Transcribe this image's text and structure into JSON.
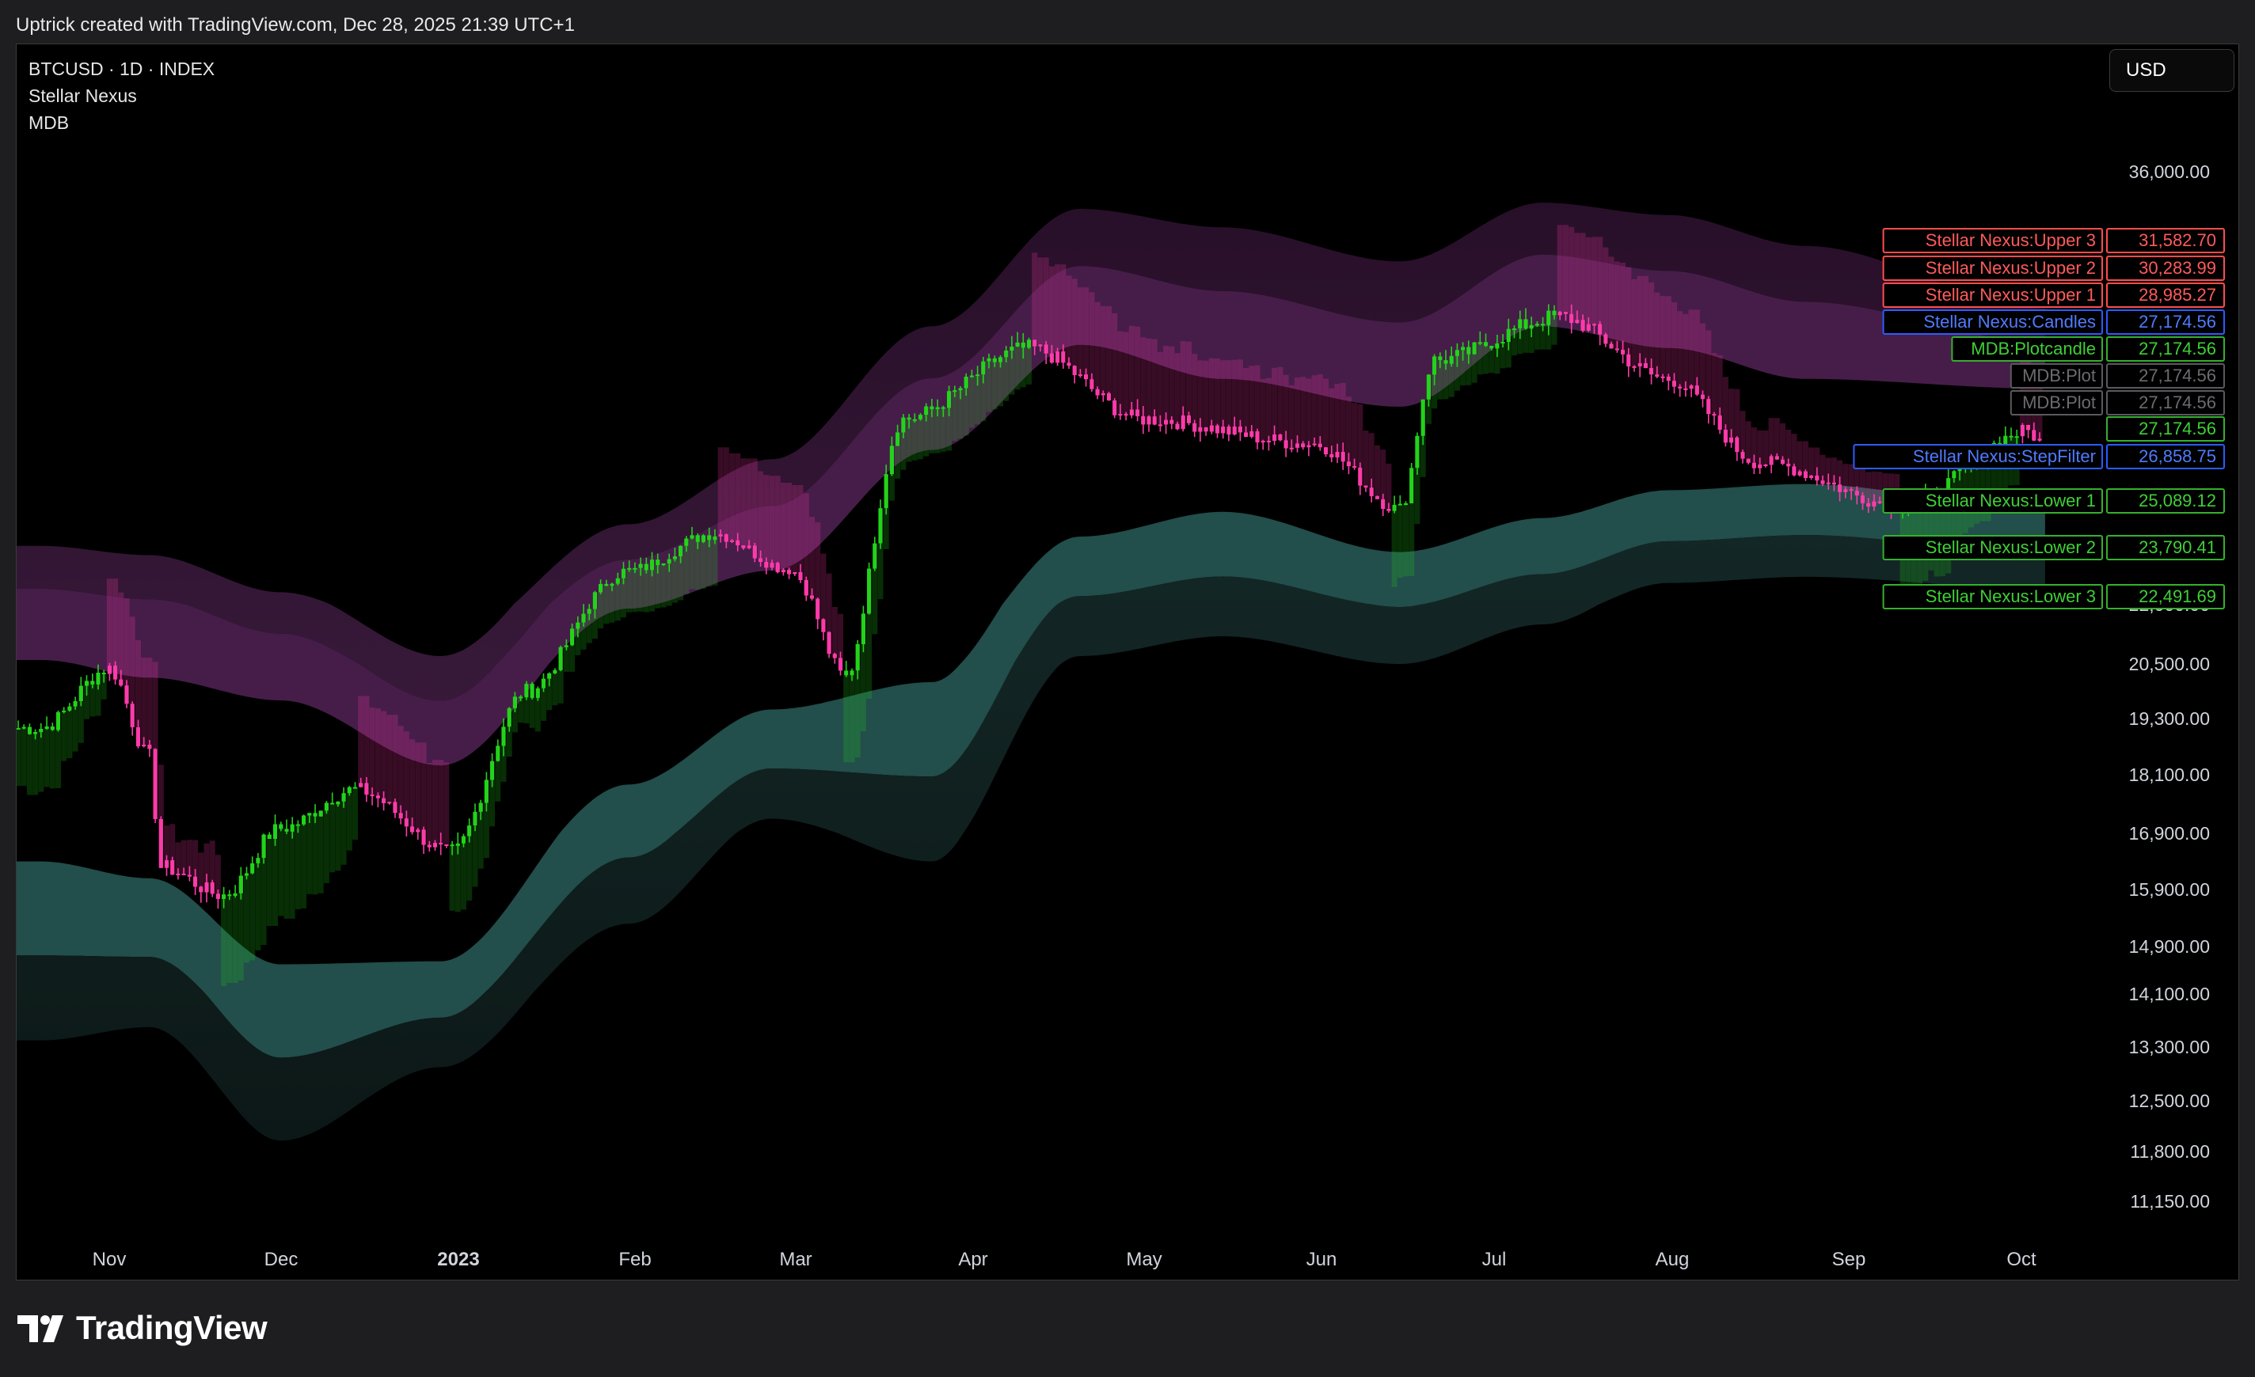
{
  "header": {
    "attribution": "Uptrick created with TradingView.com, Dec 28, 2025 21:39 UTC+1"
  },
  "legend": {
    "symbol": "BTCUSD · 1D · INDEX",
    "indicator1": "Stellar Nexus",
    "indicator2": "MDB"
  },
  "currency_button": "USD",
  "footer": {
    "brand": "TradingView"
  },
  "colors": {
    "background": "#000000",
    "bull": "#22d31a",
    "bear": "#ff3aaa",
    "upper_band": "#4a1f4d",
    "lower_band": "#24524f",
    "label_red": "#ff4d4d",
    "label_blue": "#2a5cff",
    "label_green": "#35b02e",
    "label_gray": "#5a5a5e"
  },
  "chart_data": {
    "type": "candlestick",
    "symbol": "BTCUSD",
    "interval": "1D",
    "x_axis_labels": [
      "Nov",
      "Dec",
      "2023",
      "Feb",
      "Mar",
      "Apr",
      "May",
      "Jun",
      "Jul",
      "Aug",
      "Sep",
      "Oct"
    ],
    "y_axis_ticks": [
      {
        "label": "36,000.00",
        "value": 36000
      },
      {
        "label": "22,000.00",
        "value": 22000
      },
      {
        "label": "20,500.00",
        "value": 20500
      },
      {
        "label": "19,300.00",
        "value": 19300
      },
      {
        "label": "18,100.00",
        "value": 18100
      },
      {
        "label": "16,900.00",
        "value": 16900
      },
      {
        "label": "15,900.00",
        "value": 15900
      },
      {
        "label": "14,900.00",
        "value": 14900
      },
      {
        "label": "14,100.00",
        "value": 14100
      },
      {
        "label": "13,300.00",
        "value": 13300
      },
      {
        "label": "12,500.00",
        "value": 12500
      },
      {
        "label": "11,800.00",
        "value": 11800
      },
      {
        "label": "11,150.00",
        "value": 11150
      }
    ],
    "price_labels": [
      {
        "name": "Stellar Nexus:Upper 3",
        "value": "31,582.70",
        "color": "red"
      },
      {
        "name": "Stellar Nexus:Upper 2",
        "value": "30,283.99",
        "color": "red"
      },
      {
        "name": "Stellar Nexus:Upper 1",
        "value": "28,985.27",
        "color": "red"
      },
      {
        "name": "Stellar Nexus:Candles",
        "value": "27,174.56",
        "color": "blue"
      },
      {
        "name": "MDB:Plotcandle",
        "value": "27,174.56",
        "color": "green"
      },
      {
        "name": "MDB:Plot",
        "value": "27,174.56",
        "color": "gray"
      },
      {
        "name": "MDB:Plot",
        "value": "27,174.56",
        "color": "gray"
      },
      {
        "name": "",
        "value": "27,174.56",
        "color": "green"
      },
      {
        "name": "Stellar Nexus:StepFilter",
        "value": "26,858.75",
        "color": "blue"
      },
      {
        "name": "Stellar Nexus:Lower 1",
        "value": "25,089.12",
        "color": "green"
      },
      {
        "name": "Stellar Nexus:Lower 2",
        "value": "23,790.41",
        "color": "green"
      },
      {
        "name": "Stellar Nexus:Lower 3",
        "value": "22,491.69",
        "color": "green"
      }
    ],
    "series": {
      "close": [
        {
          "date": "2022-10-20",
          "value": 19100
        },
        {
          "date": "2022-11-01",
          "value": 20400
        },
        {
          "date": "2022-11-08",
          "value": 18500
        },
        {
          "date": "2022-11-10",
          "value": 16300
        },
        {
          "date": "2022-11-21",
          "value": 15800
        },
        {
          "date": "2022-12-01",
          "value": 17000
        },
        {
          "date": "2022-12-14",
          "value": 17800
        },
        {
          "date": "2022-12-31",
          "value": 16550
        },
        {
          "date": "2023-01-13",
          "value": 19900
        },
        {
          "date": "2023-01-31",
          "value": 23100
        },
        {
          "date": "2023-02-15",
          "value": 24300
        },
        {
          "date": "2023-02-28",
          "value": 23150
        },
        {
          "date": "2023-03-10",
          "value": 20200
        },
        {
          "date": "2023-03-20",
          "value": 28000
        },
        {
          "date": "2023-04-11",
          "value": 30300
        },
        {
          "date": "2023-05-01",
          "value": 28000
        },
        {
          "date": "2023-05-31",
          "value": 27200
        },
        {
          "date": "2023-06-15",
          "value": 25100
        },
        {
          "date": "2023-06-21",
          "value": 29900
        },
        {
          "date": "2023-07-13",
          "value": 31300
        },
        {
          "date": "2023-08-01",
          "value": 29300
        },
        {
          "date": "2023-08-17",
          "value": 26600
        },
        {
          "date": "2023-09-11",
          "value": 25200
        },
        {
          "date": "2023-10-03",
          "value": 27600
        },
        {
          "date": "2023-10-06",
          "value": 27174.56
        }
      ],
      "upper_outer": [
        {
          "date": "2022-10-20",
          "value": 23900
        },
        {
          "date": "2022-11-08",
          "value": 23600
        },
        {
          "date": "2022-12-01",
          "value": 22400
        },
        {
          "date": "2022-12-29",
          "value": 20700
        },
        {
          "date": "2023-01-31",
          "value": 24600
        },
        {
          "date": "2023-02-25",
          "value": 26700
        },
        {
          "date": "2023-03-25",
          "value": 31000
        },
        {
          "date": "2023-04-20",
          "value": 34800
        },
        {
          "date": "2023-05-15",
          "value": 34200
        },
        {
          "date": "2023-06-15",
          "value": 33100
        },
        {
          "date": "2023-07-10",
          "value": 35000
        },
        {
          "date": "2023-08-01",
          "value": 34600
        },
        {
          "date": "2023-08-25",
          "value": 33600
        },
        {
          "date": "2023-10-06",
          "value": 31583
        }
      ],
      "upper_inner": [
        {
          "date": "2022-10-20",
          "value": 20600
        },
        {
          "date": "2022-11-08",
          "value": 20200
        },
        {
          "date": "2022-12-01",
          "value": 19700
        },
        {
          "date": "2022-12-29",
          "value": 18300
        },
        {
          "date": "2023-01-31",
          "value": 21900
        },
        {
          "date": "2023-02-25",
          "value": 23100
        },
        {
          "date": "2023-03-25",
          "value": 27000
        },
        {
          "date": "2023-04-20",
          "value": 30400
        },
        {
          "date": "2023-05-15",
          "value": 29300
        },
        {
          "date": "2023-06-15",
          "value": 28400
        },
        {
          "date": "2023-07-10",
          "value": 31000
        },
        {
          "date": "2023-08-01",
          "value": 30300
        },
        {
          "date": "2023-08-25",
          "value": 29300
        },
        {
          "date": "2023-10-06",
          "value": 28985
        }
      ],
      "lower_inner": [
        {
          "date": "2022-10-20",
          "value": 16400
        },
        {
          "date": "2022-11-08",
          "value": 16100
        },
        {
          "date": "2022-12-01",
          "value": 14600
        },
        {
          "date": "2022-12-29",
          "value": 14650
        },
        {
          "date": "2023-01-31",
          "value": 17900
        },
        {
          "date": "2023-02-25",
          "value": 19500
        },
        {
          "date": "2023-03-25",
          "value": 20100
        },
        {
          "date": "2023-04-20",
          "value": 24200
        },
        {
          "date": "2023-05-15",
          "value": 25000
        },
        {
          "date": "2023-06-15",
          "value": 23700
        },
        {
          "date": "2023-07-10",
          "value": 24800
        },
        {
          "date": "2023-08-01",
          "value": 25700
        },
        {
          "date": "2023-08-25",
          "value": 25900
        },
        {
          "date": "2023-10-06",
          "value": 25089
        }
      ],
      "lower_outer": [
        {
          "date": "2022-10-20",
          "value": 13400
        },
        {
          "date": "2022-11-08",
          "value": 13600
        },
        {
          "date": "2022-12-01",
          "value": 11950
        },
        {
          "date": "2022-12-29",
          "value": 13000
        },
        {
          "date": "2023-01-31",
          "value": 15300
        },
        {
          "date": "2023-02-25",
          "value": 17200
        },
        {
          "date": "2023-03-25",
          "value": 16400
        },
        {
          "date": "2023-04-20",
          "value": 20700
        },
        {
          "date": "2023-05-15",
          "value": 21200
        },
        {
          "date": "2023-06-15",
          "value": 20500
        },
        {
          "date": "2023-07-10",
          "value": 21500
        },
        {
          "date": "2023-08-01",
          "value": 22700
        },
        {
          "date": "2023-08-25",
          "value": 22900
        },
        {
          "date": "2023-10-06",
          "value": 22492
        }
      ]
    }
  }
}
